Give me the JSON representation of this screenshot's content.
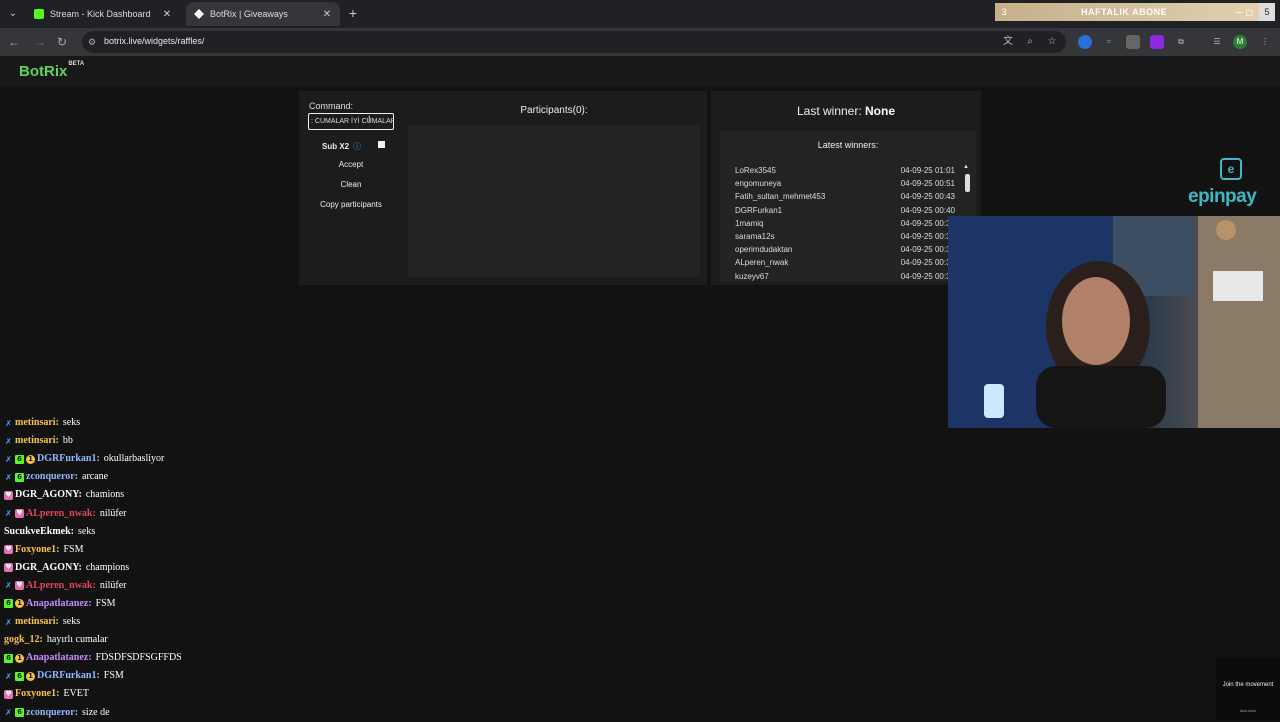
{
  "browser": {
    "tabs": [
      {
        "title": "Stream - Kick Dashboard",
        "favicon_color": "#53fc18",
        "active": false
      },
      {
        "title": "BotRix | Giveaways",
        "favicon_color": "#ffffff",
        "active": true
      }
    ],
    "url": "botrix.live/widgets/raffles/",
    "banner": {
      "count_left": "3",
      "text": "HAFTALIK ABONE",
      "count_right": "5"
    },
    "profile_initial": "M"
  },
  "app": {
    "logo": "BotRix",
    "logo_badge": "BETA"
  },
  "raffle": {
    "command_label": "Command:",
    "command_value": ": CUMALAR İYİ CUMALAR",
    "sub_label": "Sub X2",
    "accept_label": "Accept",
    "clean_label": "Clean",
    "copy_label": "Copy participants",
    "participants_title": "Participants(0):"
  },
  "winners": {
    "last_winner_label": "Last winner:",
    "last_winner_value": "None",
    "latest_title": "Latest winners:",
    "list": [
      {
        "name": "LoRex3545",
        "time": "04-09-25 01:01"
      },
      {
        "name": "engomuneya",
        "time": "04-09-25 00:51"
      },
      {
        "name": "Fatih_sultan_mehmet453",
        "time": "04-09-25 00:43"
      },
      {
        "name": "DGRFurkan1",
        "time": "04-09-25 00:40"
      },
      {
        "name": "1mamiq",
        "time": "04-09-25 00:37"
      },
      {
        "name": "sarama12s",
        "time": "04-09-25 00:35"
      },
      {
        "name": "operimdudaktan",
        "time": "04-09-25 00:34"
      },
      {
        "name": "ALperen_nwak",
        "time": "04-09-25 00:33"
      },
      {
        "name": "kuzeyv67",
        "time": "04-09-25 00:30"
      }
    ]
  },
  "sponsor": {
    "mark": "e",
    "word": "epinpay",
    "color": "#3cb7c4"
  },
  "chat": [
    {
      "user": "metinsari:",
      "text": "seks",
      "color": "#f5c542",
      "badges": [
        "✗"
      ]
    },
    {
      "user": "metinsari:",
      "text": "bb",
      "color": "#f5c542",
      "badges": [
        "✗"
      ]
    },
    {
      "user": "DGRFurkan1:",
      "text": "okullarbasliyor",
      "color": "#8fb7ff",
      "badges": [
        "✗",
        "6",
        "1"
      ]
    },
    {
      "user": "zconqueror:",
      "text": "arcane",
      "color": "#8fb7ff",
      "badges": [
        "✗",
        "6"
      ]
    },
    {
      "user": "DGR_AGONY:",
      "text": "chamions",
      "color": "#ffffff",
      "badges": [
        "♥"
      ]
    },
    {
      "user": "ALperen_nwak:",
      "text": "nilüfer",
      "color": "#e0455a",
      "badges": [
        "✗",
        "♥"
      ]
    },
    {
      "user": "SucukveEkmek:",
      "text": "seks",
      "color": "#ffffff",
      "badges": []
    },
    {
      "user": "Foxyone1:",
      "text": "FSM",
      "color": "#f5c542",
      "badges": [
        "♥"
      ]
    },
    {
      "user": "DGR_AGONY:",
      "text": "champions",
      "color": "#ffffff",
      "badges": [
        "♥"
      ]
    },
    {
      "user": "ALperen_nwak:",
      "text": "nilüfer",
      "color": "#e0455a",
      "badges": [
        "✗",
        "♥"
      ]
    },
    {
      "user": "Anapatlatanez:",
      "text": "FSM",
      "color": "#c58cff",
      "badges": [
        "6",
        "1"
      ]
    },
    {
      "user": "metinsari:",
      "text": "seks",
      "color": "#f5c542",
      "badges": [
        "✗"
      ]
    },
    {
      "user": "gogk_12:",
      "text": "hayırlı cumalar",
      "color": "#f5c542",
      "badges": []
    },
    {
      "user": "Anapatlatanez:",
      "text": "FDSDFSDFSGFFDS",
      "color": "#c58cff",
      "badges": [
        "6",
        "1"
      ]
    },
    {
      "user": "DGRFurkan1:",
      "text": "FSM",
      "color": "#8fb7ff",
      "badges": [
        "✗",
        "6",
        "1"
      ]
    },
    {
      "user": "Foxyone1:",
      "text": "EVET",
      "color": "#f5c542",
      "badges": [
        "♥"
      ]
    },
    {
      "user": "zconqueror:",
      "text": "size de",
      "color": "#8fb7ff",
      "badges": [
        "✗",
        "6"
      ]
    }
  ],
  "join_overlay": {
    "text": "Join the movement",
    "sub": "kick.com"
  }
}
